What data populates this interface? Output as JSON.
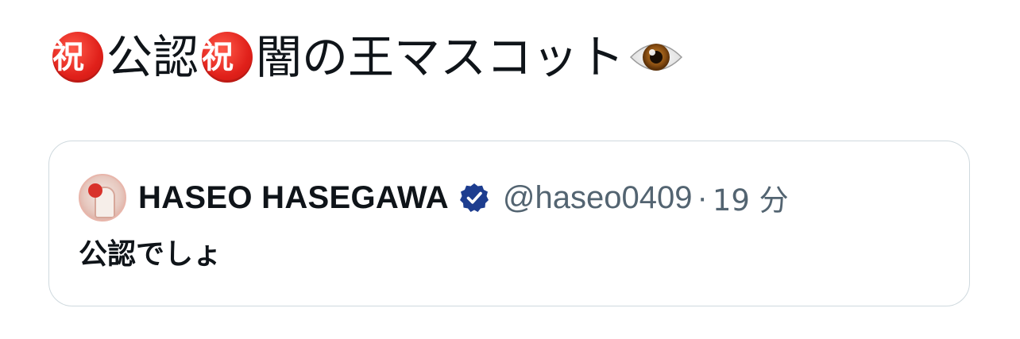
{
  "post": {
    "text_segments": [
      {
        "type": "badge",
        "value": "祝"
      },
      {
        "type": "text",
        "value": "公認"
      },
      {
        "type": "badge",
        "value": "祝"
      },
      {
        "type": "text",
        "value": "闇の王マスコット"
      }
    ],
    "badge_icon": "congratulations-emoji",
    "trailing_icon": "eye-emoji"
  },
  "quote": {
    "author_name": "HASEO HASEGAWA",
    "verified_icon": "verified-badge-icon",
    "verified_color": "#1d3d8f",
    "handle": "@haseo0409",
    "separator": "·",
    "timestamp": "19 分",
    "text": "公認でしょ"
  },
  "colors": {
    "primary_text": "#0f1419",
    "secondary_text": "#536471",
    "border": "#cfd9de",
    "badge_red": "#e0201a"
  }
}
